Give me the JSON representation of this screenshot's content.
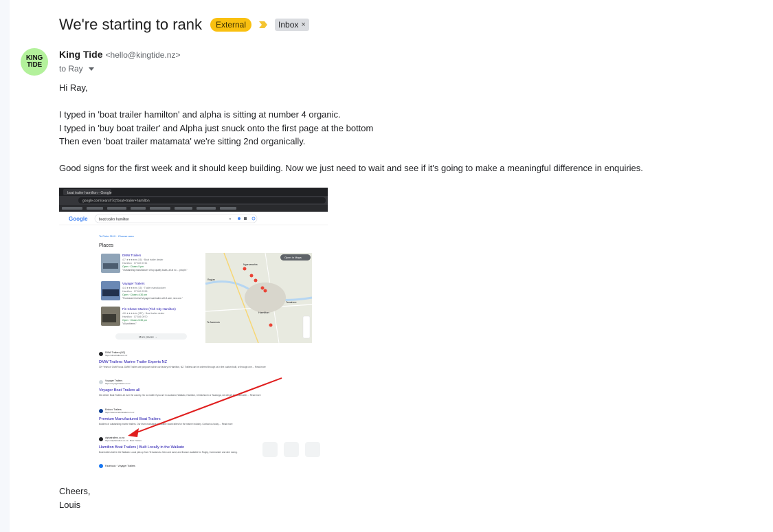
{
  "email": {
    "subject": "We're starting to rank",
    "labels": {
      "external": "External",
      "inbox": "Inbox",
      "inbox_close": "×"
    },
    "sender": {
      "avatar_line1": "KING",
      "avatar_line2": "TIDE",
      "name": "King Tide",
      "email": "<hello@kingtide.nz>",
      "to": "to Ray"
    },
    "body": {
      "greeting": "Hi Ray,",
      "line1": "I typed in 'boat trailer hamilton' and alpha is sitting at number 4 organic.",
      "line2": "I typed in 'buy boat trailer' and Alpha just snuck onto the first page at the bottom",
      "line3": "Then even 'boat trailer matamata' we're sitting 2nd organically.",
      "line4": "Good signs for the first week and it should keep building. Now we just need to wait and see if it's going to make a meaningful difference in enquiries.",
      "signoff": "Cheers,",
      "signature": "Louis"
    }
  },
  "attachment": {
    "browser": {
      "tab_title": "boat trailer hamilton - Google",
      "url": "google.com/search?q=boat+trailer+hamilton"
    },
    "google": {
      "logo": "Google",
      "query": "boat trailer hamilton",
      "location": "Te Puke 3119 · Choose area",
      "places_title": "Places",
      "places": [
        {
          "name": "DMW Trailers",
          "rating": "4.7 ★★★★★ (16) · Boat trailer dealer",
          "addr": "Hamilton · 07 849 4741",
          "hours": "Open · Closes 5 pm",
          "review": "\"Outstanding manufacturer of top quality boats, all at no ... people.\""
        },
        {
          "name": "Voyager Trailers",
          "rating": "4.4 ★★★★★ (15) · Trailer manufacturer",
          "addr": "Hamilton · 07 849 2155",
          "hours": "Open · Closes 4:30 pm",
          "review": "\"Purchased 2nd tail Voyager boat trailer with 3 axle, new one.\""
        },
        {
          "name": "Fin Chaser Marine (Fish City Hamilton)",
          "rating": "4.8 ★★★★★ (287) · Boat trailer dealer",
          "addr": "Hamilton · 07 846 0970",
          "hours": "Open · Closes 5:30 pm",
          "review": "\"All problems.\""
        }
      ],
      "more_places": "More places  →",
      "map_open": "Open in Maps",
      "map_labels": [
        "Ngaruawahia",
        "Hamilton",
        "Raglan",
        "Tamahere",
        "Te Awamutu"
      ],
      "results": [
        {
          "site": "DMW Trailers (NZ)",
          "url": "https://dmwtrailers.co.nz",
          "title": "DMW Trailers: Marine Trailer Experts NZ",
          "snippet": "30+ Years of Craft Focus. DMW Trailers are purpose built in our factory in Hamilton, NZ. Trailers can be ordered through us in the custom built, or through one ... Read more"
        },
        {
          "site": "Voyager Trailers",
          "url": "https://voyagertrailers.co.nz",
          "title": "Voyager Boat Trailers all",
          "snippet": "We deliver Boat Trailers all over the country. So no matter if you are in Auckland, Waikato, Hamilton, Christchurch or Tauranga, we will get the boat trailer ... Read more"
        },
        {
          "site": "Enduro Trailers",
          "url": "https://www.endurotrailers.co.nz",
          "title": "Premium Manufactured Boat Trailers",
          "snippet": "Builders of outstanding marine trailers. Our team manufacture durable boat trailers for the marine industry. Contact us today ... Read more"
        },
        {
          "site": "alphatrailers.co.nz",
          "url": "https://alphatrailers.co.nz › Boat Trailers",
          "title": "Hamilton Boat Trailers | Built Locally in the Waikato",
          "snippet": "Boat trailers built in the Waikato. Local pick up from Te Awamutu. New and used, and finance available for Rugby, Commander and wire racing."
        },
        {
          "site": "Facebook · Voyager Trailers",
          "url": "",
          "title": "",
          "snippet": ""
        }
      ]
    }
  }
}
